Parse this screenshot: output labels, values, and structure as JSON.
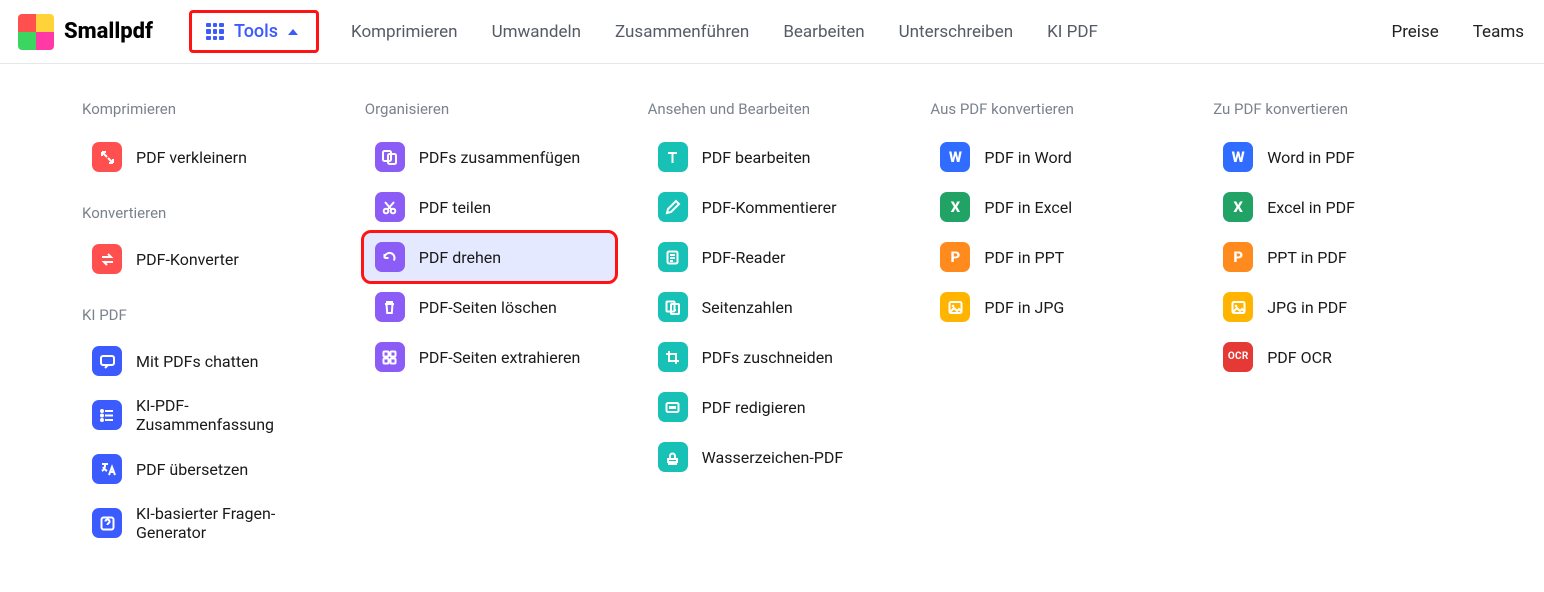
{
  "brand": {
    "name": "Smallpdf"
  },
  "nav": {
    "tools": "Tools",
    "items": [
      "Komprimieren",
      "Umwandeln",
      "Zusammenführen",
      "Bearbeiten",
      "Unterschreiben",
      "KI PDF"
    ],
    "right": [
      "Preise",
      "Teams"
    ]
  },
  "mega": {
    "columns": [
      {
        "heading": "Komprimieren",
        "groups": [
          {
            "heading": null,
            "tools": [
              {
                "id": "compress-pdf",
                "label": "PDF verkleinern",
                "icon": "compress",
                "color": "bg-red"
              }
            ]
          },
          {
            "heading": "Konvertieren",
            "tools": [
              {
                "id": "pdf-converter",
                "label": "PDF-Konverter",
                "icon": "swap",
                "color": "bg-red"
              }
            ]
          },
          {
            "heading": "KI PDF",
            "tools": [
              {
                "id": "chat-pdf",
                "label": "Mit PDFs chatten",
                "icon": "chat",
                "color": "bg-indigo"
              },
              {
                "id": "ai-summary",
                "label": "KI-PDF-Zusammenfassung",
                "icon": "list",
                "color": "bg-indigo"
              },
              {
                "id": "translate-pdf",
                "label": "PDF übersetzen",
                "icon": "translate",
                "color": "bg-indigo"
              },
              {
                "id": "ai-questions",
                "label": "KI-basierter Fragen-Generator",
                "icon": "question",
                "color": "bg-indigo"
              }
            ]
          }
        ]
      },
      {
        "heading": "Organisieren",
        "groups": [
          {
            "heading": null,
            "tools": [
              {
                "id": "merge-pdf",
                "label": "PDFs zusammenfügen",
                "icon": "merge",
                "color": "bg-purple"
              },
              {
                "id": "split-pdf",
                "label": "PDF teilen",
                "icon": "cut",
                "color": "bg-purple"
              },
              {
                "id": "rotate-pdf",
                "label": "PDF drehen",
                "icon": "rotate",
                "color": "bg-purple",
                "highlight": true
              },
              {
                "id": "delete-pages",
                "label": "PDF-Seiten löschen",
                "icon": "trash",
                "color": "bg-purple"
              },
              {
                "id": "extract-pages",
                "label": "PDF-Seiten extrahieren",
                "icon": "grid",
                "color": "bg-purple"
              }
            ]
          }
        ]
      },
      {
        "heading": "Ansehen und Bearbeiten",
        "groups": [
          {
            "heading": null,
            "tools": [
              {
                "id": "edit-pdf",
                "label": "PDF bearbeiten",
                "icon": "text",
                "color": "bg-teal"
              },
              {
                "id": "annotate-pdf",
                "label": "PDF-Kommentierer",
                "icon": "pen",
                "color": "bg-teal"
              },
              {
                "id": "pdf-reader",
                "label": "PDF-Reader",
                "icon": "doc",
                "color": "bg-teal"
              },
              {
                "id": "page-numbers",
                "label": "Seitenzahlen",
                "icon": "pagenum",
                "color": "bg-teal"
              },
              {
                "id": "crop-pdf",
                "label": "PDFs zuschneiden",
                "icon": "crop",
                "color": "bg-teal"
              },
              {
                "id": "redact-pdf",
                "label": "PDF redigieren",
                "icon": "redact",
                "color": "bg-teal"
              },
              {
                "id": "watermark-pdf",
                "label": "Wasserzeichen-PDF",
                "icon": "stamp",
                "color": "bg-teal"
              }
            ]
          }
        ]
      },
      {
        "heading": "Aus PDF konvertieren",
        "groups": [
          {
            "heading": null,
            "tools": [
              {
                "id": "pdf-to-word",
                "label": "PDF in Word",
                "icon": "W",
                "color": "bg-blue",
                "glyph": true
              },
              {
                "id": "pdf-to-excel",
                "label": "PDF in Excel",
                "icon": "X",
                "color": "bg-green",
                "glyph": true
              },
              {
                "id": "pdf-to-ppt",
                "label": "PDF in PPT",
                "icon": "P",
                "color": "bg-orange",
                "glyph": true
              },
              {
                "id": "pdf-to-jpg",
                "label": "PDF in JPG",
                "icon": "image",
                "color": "bg-amber"
              }
            ]
          }
        ]
      },
      {
        "heading": "Zu PDF konvertieren",
        "groups": [
          {
            "heading": null,
            "tools": [
              {
                "id": "word-to-pdf",
                "label": "Word in PDF",
                "icon": "W",
                "color": "bg-blue",
                "glyph": true
              },
              {
                "id": "excel-to-pdf",
                "label": "Excel in PDF",
                "icon": "X",
                "color": "bg-green",
                "glyph": true
              },
              {
                "id": "ppt-to-pdf",
                "label": "PPT in PDF",
                "icon": "P",
                "color": "bg-orange",
                "glyph": true
              },
              {
                "id": "jpg-to-pdf",
                "label": "JPG in PDF",
                "icon": "image",
                "color": "bg-amber"
              },
              {
                "id": "pdf-ocr",
                "label": "PDF OCR",
                "icon": "OCR",
                "color": "bg-scarlet",
                "glyph": true,
                "ocr": true
              }
            ]
          }
        ]
      }
    ]
  }
}
